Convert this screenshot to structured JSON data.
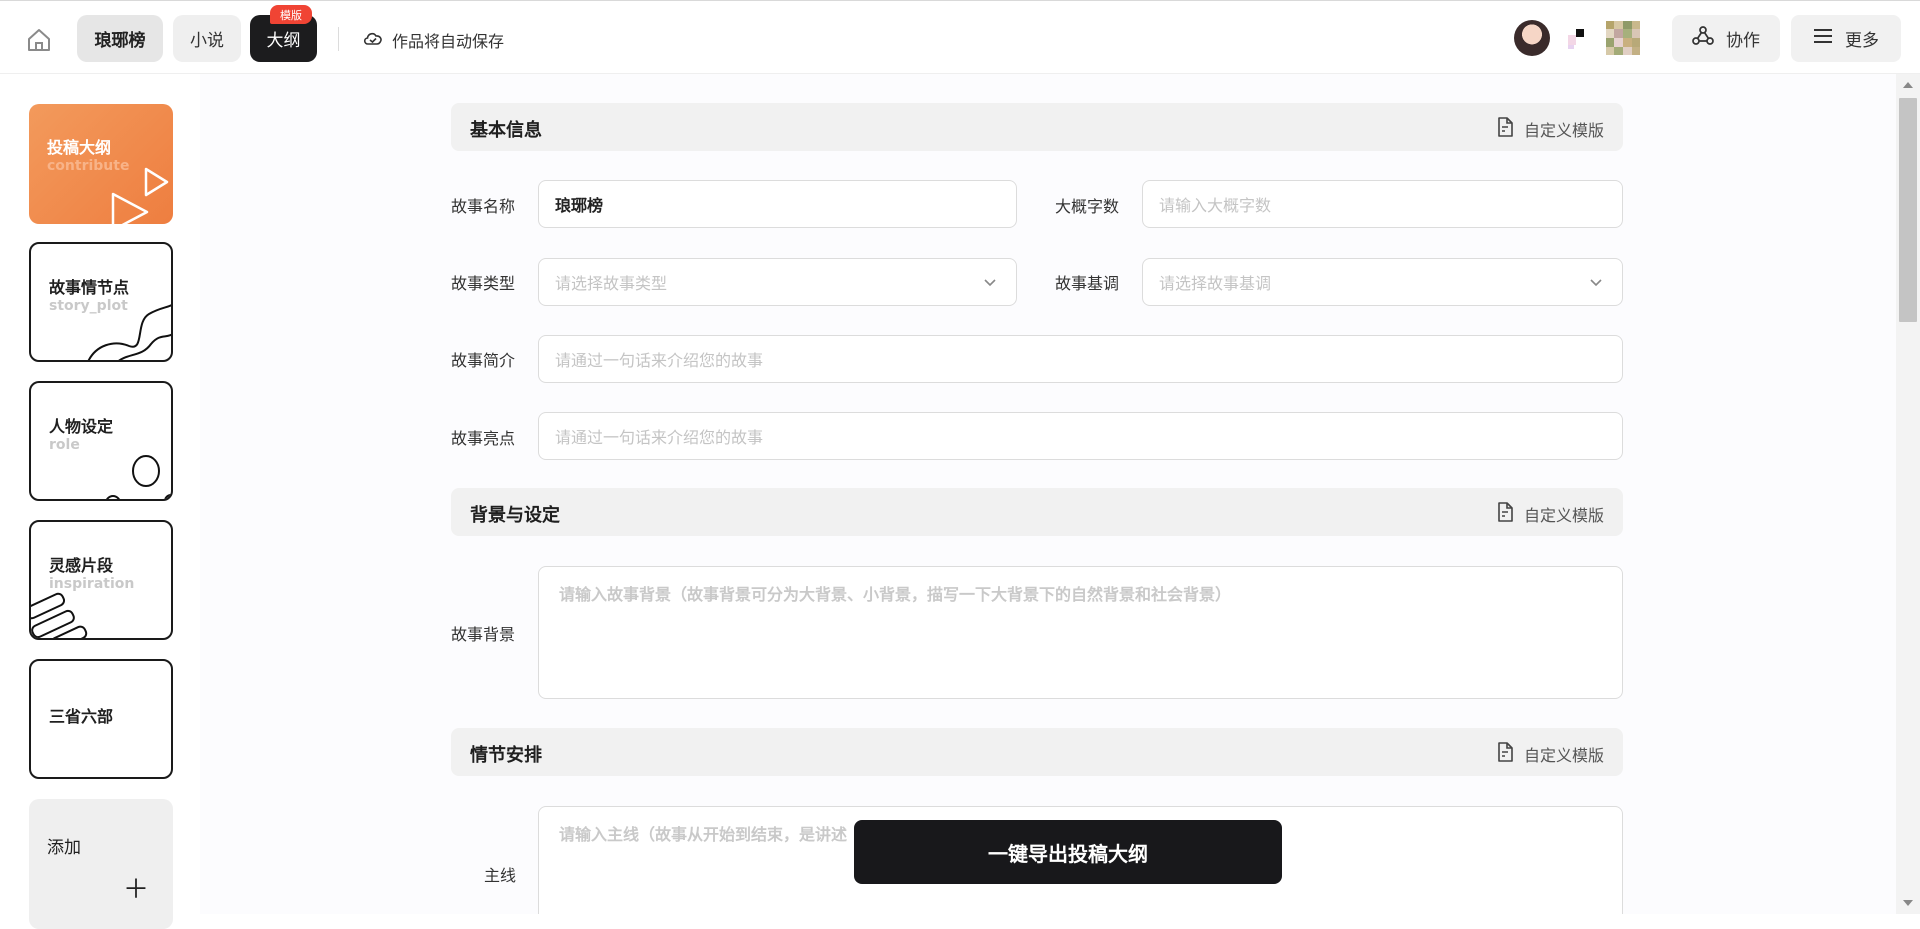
{
  "header": {
    "tabs": [
      {
        "label": "琅琊榜"
      },
      {
        "label": "小说"
      },
      {
        "label": "大纲"
      }
    ],
    "badge": "模版",
    "autosave": "作品将自动保存",
    "collab_label": "协作",
    "more_label": "更多"
  },
  "sidebar": {
    "cards": [
      {
        "title": "投稿大纲",
        "sub": "contribute"
      },
      {
        "title": "故事情节点",
        "sub": "story_plot"
      },
      {
        "title": "人物设定",
        "sub": "role"
      },
      {
        "title": "灵感片段",
        "sub": "inspiration"
      },
      {
        "title": "三省六部",
        "sub": ""
      },
      {
        "title": "添加",
        "sub": ""
      }
    ]
  },
  "sections": {
    "basic": {
      "title": "基本信息",
      "custom": "自定义模版"
    },
    "background": {
      "title": "背景与设定",
      "custom": "自定义模版"
    },
    "plot": {
      "title": "情节安排",
      "custom": "自定义模版"
    }
  },
  "fields": {
    "story_name": {
      "label": "故事名称",
      "value": "琅琊榜"
    },
    "word_count": {
      "label": "大概字数",
      "placeholder": "请输入大概字数"
    },
    "story_type": {
      "label": "故事类型",
      "placeholder": "请选择故事类型"
    },
    "story_tone": {
      "label": "故事基调",
      "placeholder": "请选择故事基调"
    },
    "summary": {
      "label": "故事简介",
      "placeholder": "请通过一句话来介绍您的故事"
    },
    "highlight": {
      "label": "故事亮点",
      "placeholder": "请通过一句话来介绍您的故事"
    },
    "background": {
      "label": "故事背景",
      "placeholder": "请输入故事背景（故事背景可分为大背景、小背景，描写一下大背景下的自然背景和社会背景）"
    },
    "mainline": {
      "label": "主线",
      "placeholder": "请输入主线（故事从开始到结束，是讲述"
    }
  },
  "export_button": "一键导出投稿大纲"
}
